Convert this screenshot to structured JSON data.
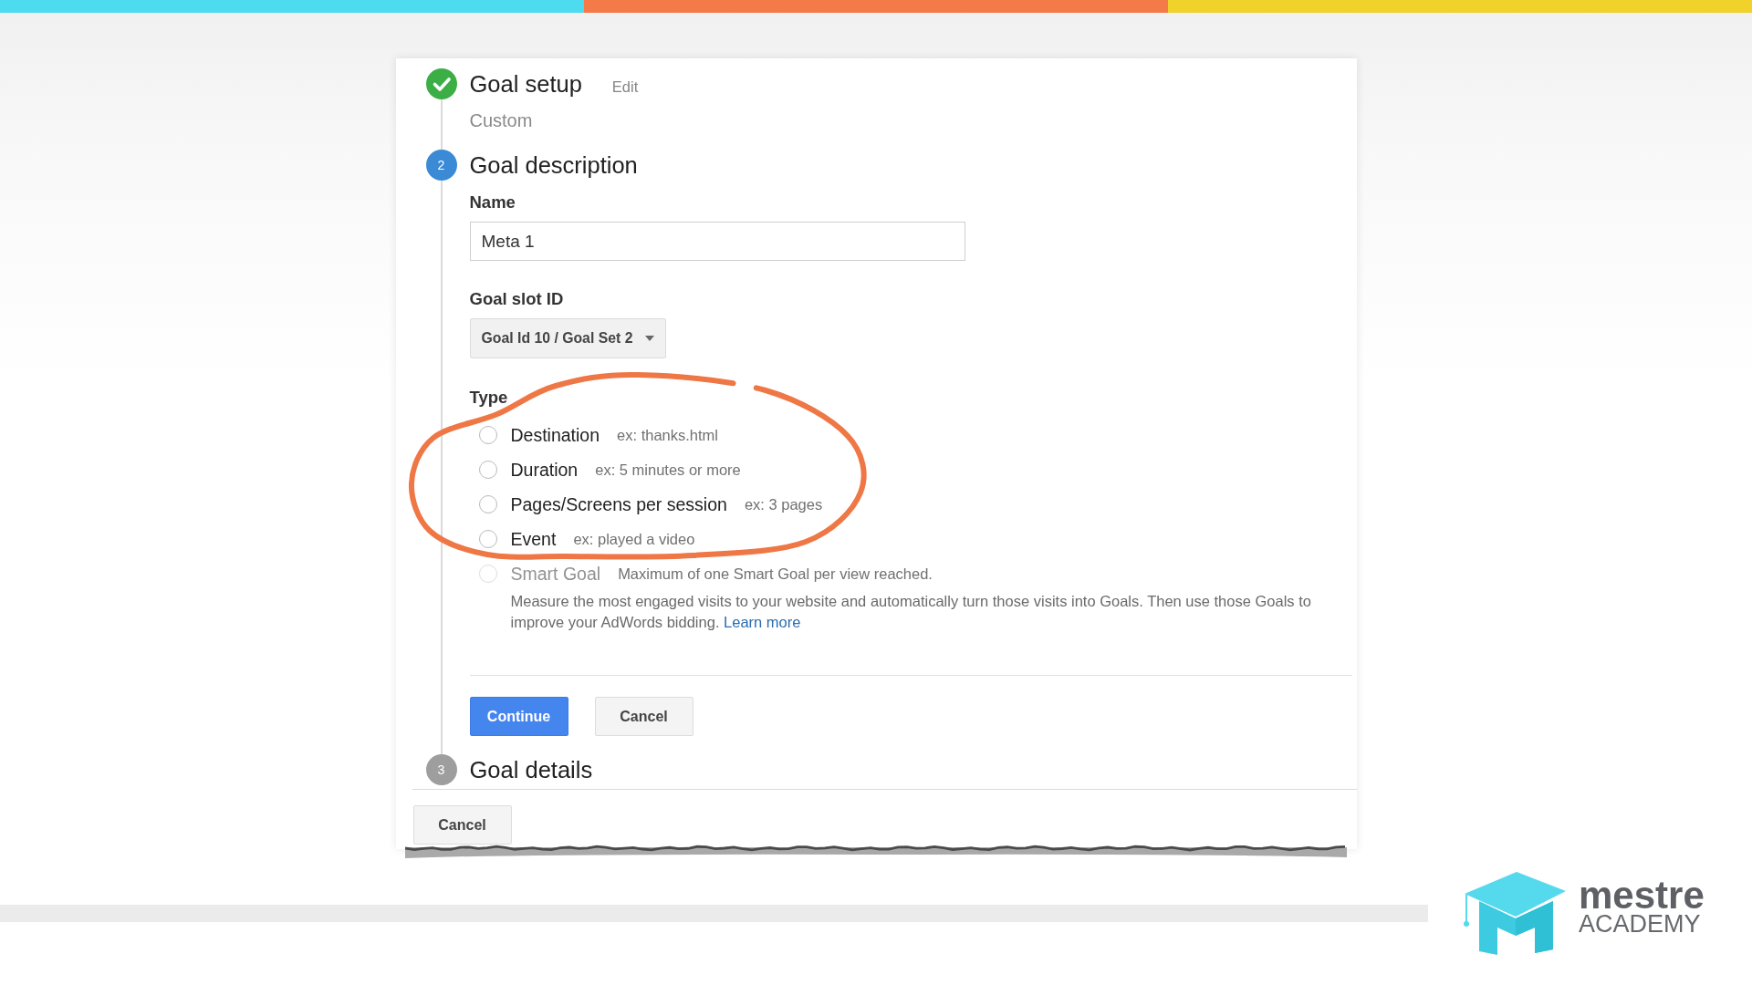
{
  "steps": [
    {
      "kind": "complete",
      "title": "Goal setup",
      "action": "Edit",
      "summary": "Custom"
    },
    {
      "kind": "current",
      "number": "2",
      "title": "Goal description",
      "form": {
        "name_field": {
          "label": "Name",
          "value": "Meta 1"
        },
        "slot_field": {
          "label": "Goal slot ID",
          "value": "Goal Id 10 / Goal Set 2"
        },
        "type_field": {
          "label": "Type",
          "options": [
            {
              "label": "Destination",
              "hint": "ex: thanks.html",
              "selected": false,
              "disabled": false
            },
            {
              "label": "Duration",
              "hint": "ex: 5 minutes or more",
              "selected": false,
              "disabled": false
            },
            {
              "label": "Pages/Screens per session",
              "hint": "ex: 3 pages",
              "selected": false,
              "disabled": false
            },
            {
              "label": "Event",
              "hint": "ex: played a video",
              "selected": false,
              "disabled": false
            },
            {
              "label": "Smart Goal",
              "hint": "Maximum of one Smart Goal per view reached.",
              "selected": false,
              "disabled": true
            }
          ],
          "note": "Measure the most engaged visits to your website and automatically turn those visits into Goals. Then use those Goals to improve your AdWords bidding.",
          "note_link": "Learn more"
        }
      },
      "buttons": [
        {
          "label": "Continue",
          "kind": "primary"
        },
        {
          "label": "Cancel",
          "kind": "secondary"
        }
      ]
    },
    {
      "kind": "pending",
      "number": "3",
      "title": "Goal details"
    }
  ],
  "cancel_button": "Cancel",
  "logo": {
    "name": "mestre",
    "tagline": "ACADEMY"
  }
}
